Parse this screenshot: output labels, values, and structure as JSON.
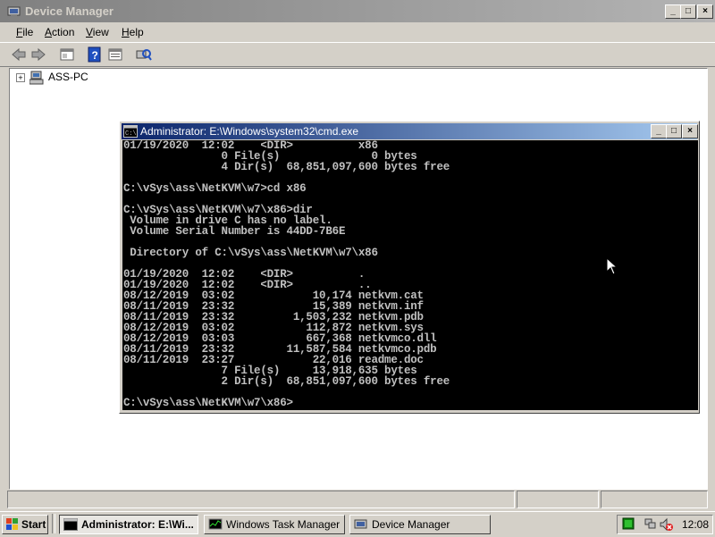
{
  "device_manager": {
    "title": "Device Manager",
    "window_controls": [
      "minimize",
      "maximize",
      "close"
    ],
    "menu": [
      {
        "label": "File"
      },
      {
        "label": "Action"
      },
      {
        "label": "View"
      },
      {
        "label": "Help"
      }
    ],
    "toolbar": [
      "back-icon",
      "forward-icon",
      "properties-icon",
      "help-icon",
      "view-icon",
      "scan-hardware-icon"
    ],
    "tree_root": {
      "label": "ASS-PC",
      "expander": "+"
    }
  },
  "cmd": {
    "title": "Administrator: E:\\Windows\\system32\\cmd.exe",
    "lines": [
      "01/19/2020  12:02    <DIR>          x86",
      "               0 File(s)              0 bytes",
      "               4 Dir(s)  68,851,097,600 bytes free",
      "",
      "C:\\vSys\\ass\\NetKVM\\w7>cd x86",
      "",
      "C:\\vSys\\ass\\NetKVM\\w7\\x86>dir",
      " Volume in drive C has no label.",
      " Volume Serial Number is 44DD-7B6E",
      "",
      " Directory of C:\\vSys\\ass\\NetKVM\\w7\\x86",
      "",
      "01/19/2020  12:02    <DIR>          .",
      "01/19/2020  12:02    <DIR>          ..",
      "08/12/2019  03:02            10,174 netkvm.cat",
      "08/11/2019  23:32            15,389 netkvm.inf",
      "08/11/2019  23:32         1,503,232 netkvm.pdb",
      "08/12/2019  03:02           112,872 netkvm.sys",
      "08/12/2019  03:03           667,368 netkvmco.dll",
      "08/11/2019  23:32        11,587,584 netkvmco.pdb",
      "08/11/2019  23:27            22,016 readme.doc",
      "               7 File(s)     13,918,635 bytes",
      "               2 Dir(s)  68,851,097,600 bytes free",
      "",
      "C:\\vSys\\ass\\NetKVM\\w7\\x86>"
    ]
  },
  "taskbar": {
    "start_label": "Start",
    "tasks": [
      {
        "label": "Administrator: E:\\Wi...",
        "active": true
      },
      {
        "label": "Windows Task Manager",
        "active": false
      },
      {
        "label": "Device Manager",
        "active": false
      }
    ],
    "clock": "12:08"
  },
  "colors": {
    "inactive_title": "#808080",
    "active_title": "#0a246a",
    "console_bg": "#000000",
    "console_fg": "#c0c0c0",
    "face": "#d4d0c8"
  }
}
